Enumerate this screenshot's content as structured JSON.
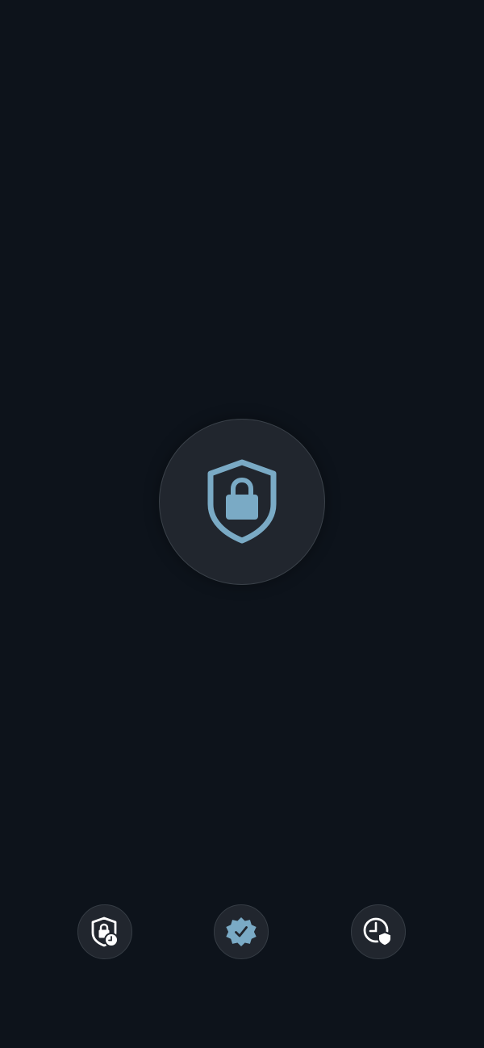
{
  "colors": {
    "background": "#0d131b",
    "button_fill": "#21262e",
    "accent": "#7aaac5",
    "icon_light": "#ffffff"
  },
  "center_button": {
    "icon": "shield-lock-icon"
  },
  "bottom_nav": {
    "items": [
      {
        "id": "lock-schedule",
        "icon": "shield-lock-clock-icon"
      },
      {
        "id": "verified",
        "icon": "verified-badge-icon"
      },
      {
        "id": "history",
        "icon": "clock-shield-icon"
      }
    ]
  }
}
